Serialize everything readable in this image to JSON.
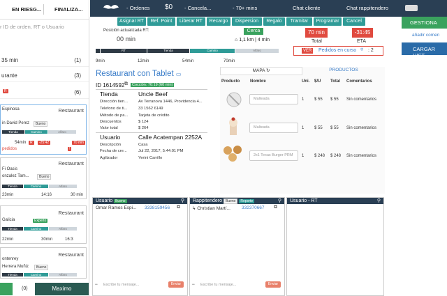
{
  "left": {
    "tabs": [
      "EN RIESG...",
      "FINALIZA..."
    ],
    "search_placeholder": "r ID de orden, RT o Usuario",
    "groups": [
      {
        "label": "35 min",
        "count": "(1)"
      },
      {
        "label": "urante",
        "count": "(3)"
      },
      {
        "label": "",
        "count": "(6)"
      }
    ],
    "cards": [
      {
        "name": "Espinosa",
        "rest": "Restaurant",
        "line2": "in David Perez",
        "badge": "Bueno",
        "bars": [
          "Tienda",
          "Camino",
          "Alfaro"
        ],
        "time1": "54min",
        "red1": "-25:42",
        "red2": "70 min",
        "alert": "pedidos"
      },
      {
        "name": "",
        "rest": "Restaurant",
        "line2": "Fi Oasis",
        "line3": "onzalez Tam...",
        "badge": "Bueno",
        "bars": [
          "Tienda",
          "Camino",
          "Alfaro"
        ],
        "times": [
          "23min",
          "14:16",
          "30 min"
        ]
      },
      {
        "name": "Galicia",
        "rest": "Restaurant",
        "badge": "Experto",
        "bars": [
          "Tienda",
          "Camino",
          "Alfaro"
        ],
        "times": [
          "22min",
          "30min",
          "16:3"
        ]
      },
      {
        "name": "",
        "rest": "Restaurant",
        "line2": "ontenrey",
        "line3": "Herrera Muñiz",
        "badge": "Bueno",
        "bars": [
          "Tienda",
          "Camino",
          "Alfaro"
        ],
        "times": [
          "",
          "54min",
          "70min"
        ]
      }
    ],
    "bottom_count": "(0)",
    "bottom_button": "Maximo"
  },
  "topbar": {
    "ordenes": "- Ordenes",
    "money": "$0",
    "cancel": "- Cancela...",
    "mins": "- 70+ mins",
    "chat_cliente": "Chat cliente",
    "chat_rappi": "Chat rappitendero",
    "gestiona": "GESTIONA"
  },
  "actions": [
    "Asignar RT",
    "Ref. Point",
    "Liberar RT",
    "Recargo",
    "Dispersion",
    "Regalo",
    "Tramitar",
    "Programar",
    "Cancel"
  ],
  "status": {
    "pos_label": "Posición actualizada RT:",
    "pos_value": "00 min",
    "cerca": "Cerca",
    "distance": "1,1 km | 4 min",
    "total_value": "70 min",
    "total_label": "Total",
    "eta_value": "-31:45",
    "eta_label": "ETA",
    "ver": "VER",
    "pedidos_curso": "Pedidos en curso",
    "pedidos_count": ": 2",
    "add_comment": "añadir comen",
    "cargar": "CARGAR HIST"
  },
  "timeline": {
    "labels": [
      "RT",
      "Tienda",
      "Camino",
      "Alfaro"
    ],
    "times": [
      "9min",
      "12min",
      "54min",
      "70min"
    ]
  },
  "order": {
    "restaurant": "Restaurant con Tablet",
    "id": "ID 1614592",
    "coccion": "Cocción: 70:19 (60 min)",
    "store_head": "Tienda",
    "store_name": "Uncle Beef",
    "store_fields": [
      {
        "k": "Dirección tien...",
        "v": "Av Terranova 1446, Providencia 4..."
      },
      {
        "k": "Telefono de ti...",
        "v": "33 1562 6149"
      },
      {
        "k": "Método de pa...",
        "v": "Tarjeta de crédito"
      },
      {
        "k": "Descuentos",
        "v": "$ 124"
      },
      {
        "k": "Valor total",
        "v": "$ 264"
      }
    ],
    "user_head": "Usuario",
    "user_addr": "Calle Acatempan 2252A",
    "user_fields": [
      {
        "k": "Descripción",
        "v": "Casa"
      },
      {
        "k": "Fecha de cre...",
        "v": "Jul 22, 2017, 5:44:01 PM"
      },
      {
        "k": "Agilizador",
        "v": "Yerini Carrillo"
      }
    ]
  },
  "products": {
    "tab_map": "MAPA",
    "tab_products": "PRODUCTOS",
    "headers": [
      "Producto",
      "Nombre",
      "Uni.",
      "$/U",
      "Total",
      "Comentarios"
    ],
    "rows": [
      {
        "name": "Malteada",
        "uni": "1",
        "pu": "$ 55",
        "total": "$ 55",
        "comment": "Sin comentarios"
      },
      {
        "name": "Malteada",
        "uni": "1",
        "pu": "$ 55",
        "total": "$ 55",
        "comment": "Sin comentarios"
      },
      {
        "name": "2x1 Texas Burger PRM",
        "uni": "1",
        "pu": "$ 248",
        "total": "$ 248",
        "comment": "Sin comentarios"
      }
    ]
  },
  "chats": {
    "usuario": {
      "title": "Usuario",
      "badge": "Bueno",
      "name": "Omar Ramos Espi...",
      "phone": "3338159456",
      "placeholder": "Escribe tu mensaje...",
      "send": "Enviar"
    },
    "rappi": {
      "title": "Rappitendero",
      "badge1": "Bueno",
      "badge2": "Reporte",
      "name": "Christian Martí...",
      "phone": "332370667",
      "placeholder": "Escribe tu mensaje...",
      "send": "Enviar"
    },
    "rt": {
      "title": "Usuario - RT"
    }
  },
  "colors": {
    "navy": "#2a3f54",
    "teal": "#2f9b97",
    "red": "#e04a3f",
    "green": "#3aa25e"
  }
}
